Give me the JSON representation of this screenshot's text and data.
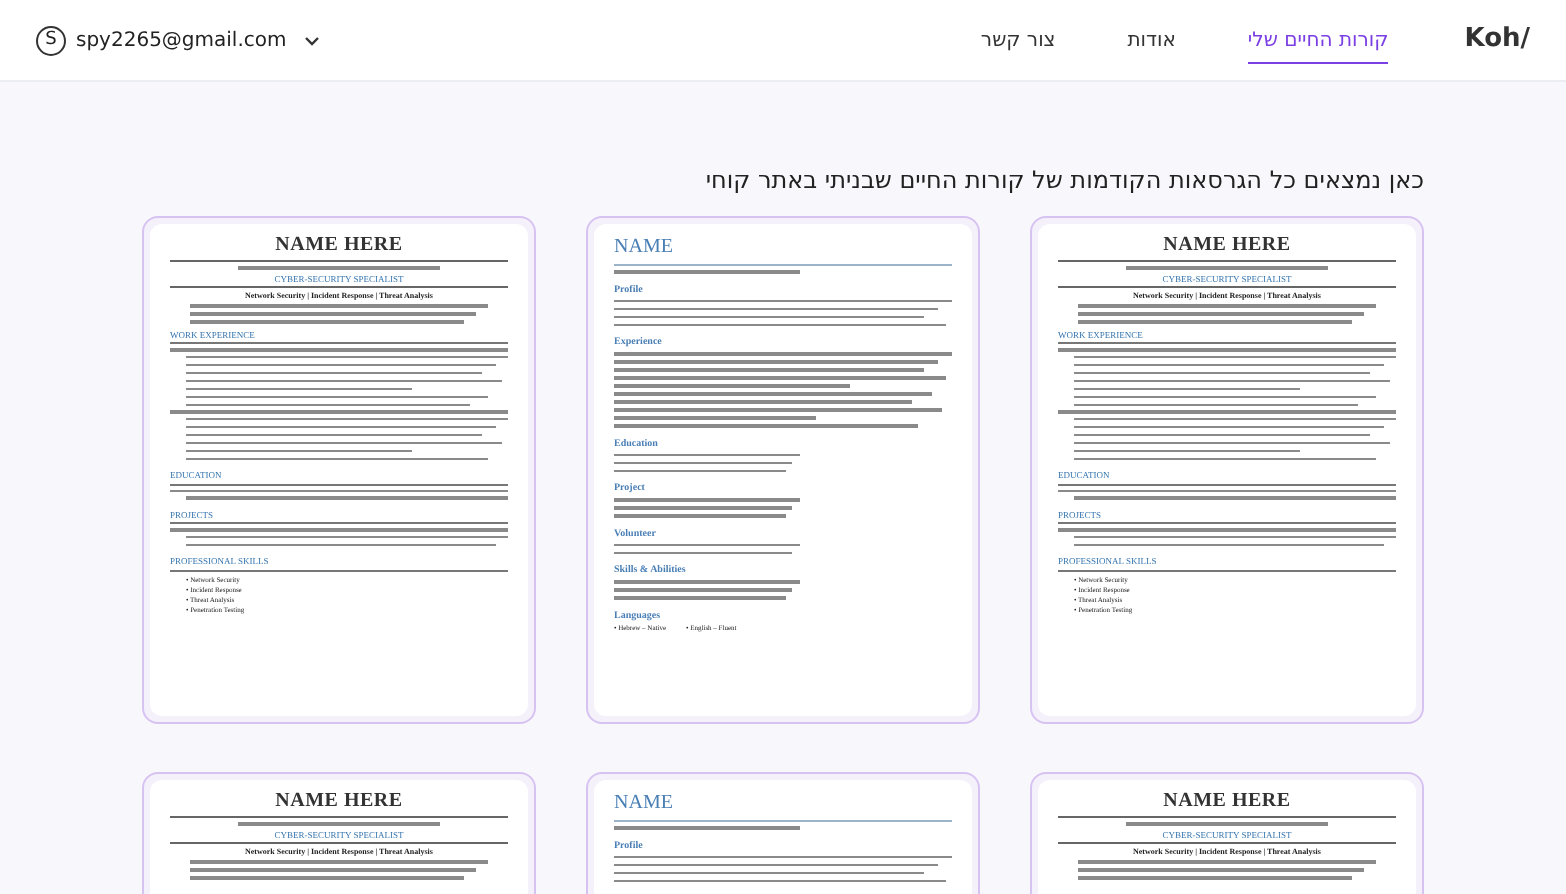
{
  "header": {
    "logo": "Koh/",
    "nav": [
      {
        "label": "קורות החיים שלי",
        "selected": true
      },
      {
        "label": "אודות",
        "selected": false
      },
      {
        "label": "צור קשר",
        "selected": false
      }
    ],
    "account": {
      "avatar": "S",
      "email": "spy2265@gmail.com"
    }
  },
  "heading": "כאן נמצאים כל הגרסאות הקודמות של קורות החיים שבניתי באתר קוחי",
  "resumes": [
    {
      "kind": "cyber",
      "name": "NAME HERE",
      "title": "CYBER-SECURITY SPECIALIST",
      "tagline": "Network Security | Incident Response | Threat Analysis",
      "sections": [
        {
          "heading": "WORK EXPERIENCE"
        },
        {
          "heading": "EDUCATION"
        },
        {
          "heading": "PROJECTS"
        },
        {
          "heading": "PROFESSIONAL SKILLS",
          "items": [
            "• Network Security",
            "• Incident Response",
            "• Threat Analysis",
            "• Penetration Testing"
          ]
        }
      ]
    },
    {
      "kind": "basic",
      "name": "NAME",
      "sections": [
        {
          "heading": "Profile"
        },
        {
          "heading": "Experience"
        },
        {
          "heading": "Education"
        },
        {
          "heading": "Project"
        },
        {
          "heading": "Volunteer"
        },
        {
          "heading": "Skills & Abilities"
        },
        {
          "heading": "Languages",
          "items": [
            "• Hebrew – Native",
            "• English – Fluent"
          ]
        }
      ]
    },
    {
      "kind": "cyber",
      "name": "NAME HERE",
      "title": "CYBER-SECURITY SPECIALIST",
      "tagline": "Network Security | Incident Response | Threat Analysis",
      "sections": [
        {
          "heading": "WORK EXPERIENCE"
        },
        {
          "heading": "EDUCATION"
        },
        {
          "heading": "PROJECTS"
        },
        {
          "heading": "PROFESSIONAL SKILLS",
          "items": [
            "• Network Security",
            "• Incident Response",
            "• Threat Analysis",
            "• Penetration Testing"
          ]
        }
      ]
    },
    {
      "kind": "cyber",
      "name": "NAME HERE",
      "title": "CYBER-SECURITY SPECIALIST",
      "tagline": "Network Security | Incident Response | Threat Analysis"
    },
    {
      "kind": "basic",
      "name": "NAME",
      "sections": [
        {
          "heading": "Profile"
        }
      ]
    },
    {
      "kind": "cyber",
      "name": "NAME HERE",
      "title": "CYBER-SECURITY SPECIALIST",
      "tagline": "Network Security | Incident Response | Threat Analysis"
    }
  ]
}
